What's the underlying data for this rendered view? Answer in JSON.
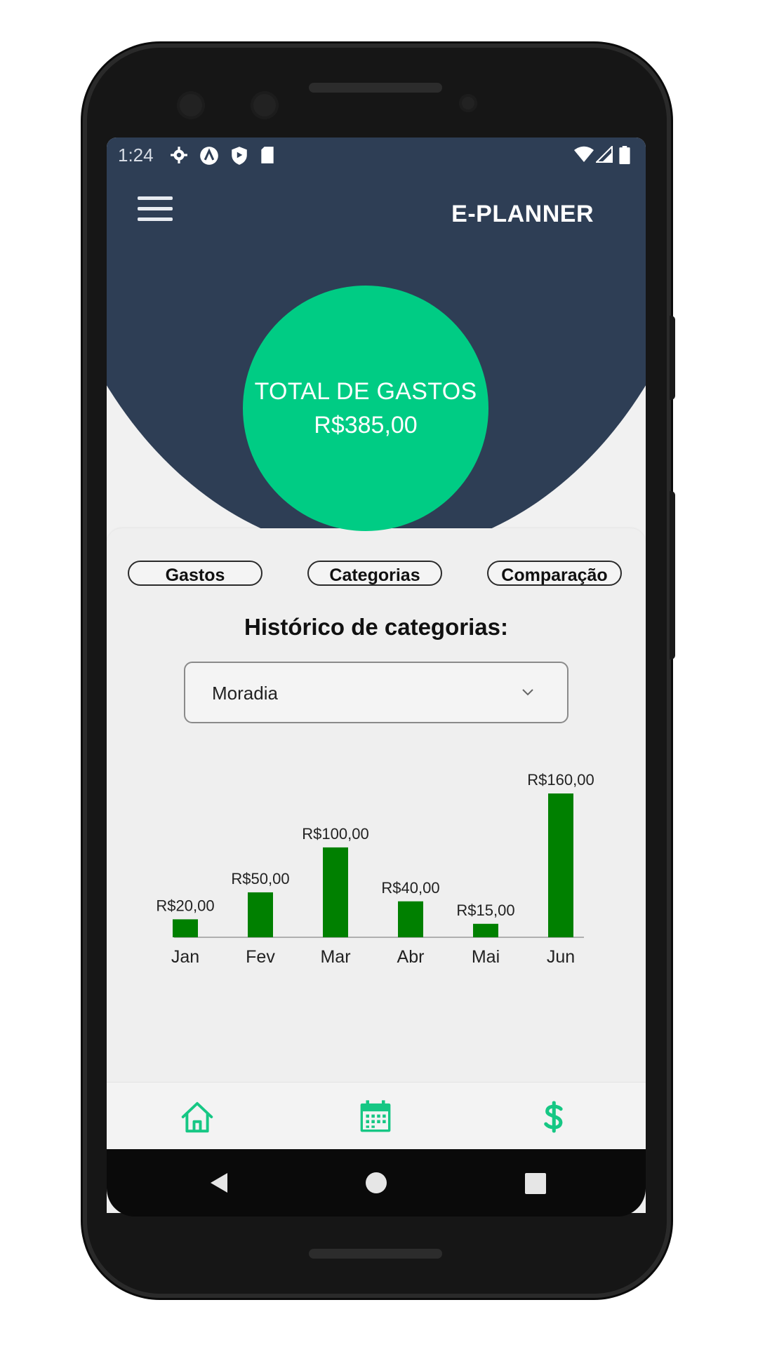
{
  "status_bar": {
    "time": "1:24",
    "left_icons": [
      "settings-icon",
      "a-circle-icon",
      "shield-icon",
      "sd-card-icon"
    ],
    "right_icons": [
      "wifi-icon",
      "signal-icon",
      "battery-icon"
    ]
  },
  "header": {
    "title": "E-PLANNER",
    "menu_icon": "hamburger-menu-icon"
  },
  "summary": {
    "label": "TOTAL DE GASTOS",
    "value": "R$385,00"
  },
  "tabs": [
    {
      "label": "Gastos"
    },
    {
      "label": "Categorias"
    },
    {
      "label": "Comparação"
    }
  ],
  "section": {
    "title": "Histórico de categorias:"
  },
  "category_select": {
    "value": "Moradia"
  },
  "chart_data": {
    "type": "bar",
    "categories": [
      "Jan",
      "Fev",
      "Mar",
      "Abr",
      "Mai",
      "Jun"
    ],
    "values": [
      20,
      50,
      100,
      40,
      15,
      160
    ],
    "data_labels": [
      "R$20,00",
      "R$50,00",
      "R$100,00",
      "R$40,00",
      "R$15,00",
      "R$160,00"
    ],
    "title": "",
    "xlabel": "",
    "ylabel": "",
    "ylim": [
      0,
      160
    ],
    "grid": false,
    "color": "#008000"
  },
  "bottom_nav": [
    {
      "icon": "home-icon"
    },
    {
      "icon": "calendar-icon"
    },
    {
      "icon": "dollar-icon"
    }
  ],
  "colors": {
    "header": "#2e3e55",
    "accent": "#00cc84",
    "bar": "#008000",
    "nav_icon": "#16c784"
  }
}
